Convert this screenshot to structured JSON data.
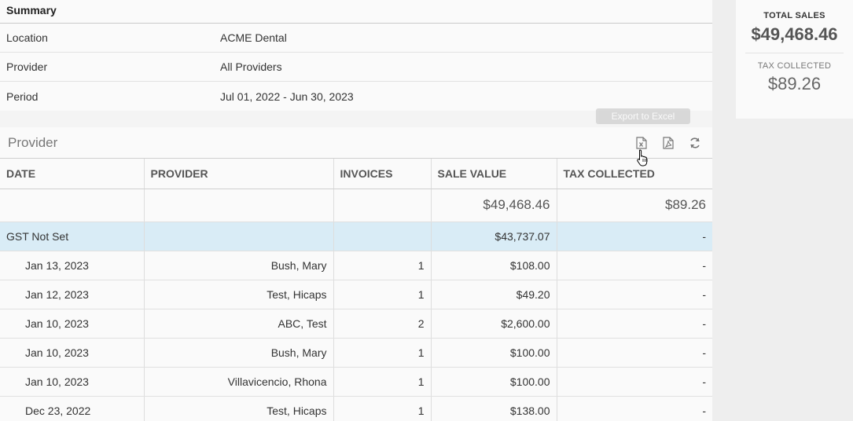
{
  "summary": {
    "title": "Summary",
    "rows": [
      {
        "label": "Location",
        "value": "ACME Dental"
      },
      {
        "label": "Provider",
        "value": "All Providers"
      },
      {
        "label": "Period",
        "value": "Jul 01, 2022 - Jun 30, 2023"
      }
    ]
  },
  "panel": {
    "title": "Provider",
    "tooltip": "Export to Excel",
    "tools": [
      "excel-export-icon",
      "pdf-export-icon",
      "refresh-icon"
    ]
  },
  "table": {
    "headers": [
      "DATE",
      "PROVIDER",
      "INVOICES",
      "SALE VALUE",
      "TAX COLLECTED"
    ],
    "totals": {
      "sale_value": "$49,468.46",
      "tax_collected": "$89.26"
    },
    "group": {
      "label": "GST Not Set",
      "sale_value": "$43,737.07",
      "tax_collected": "-"
    },
    "rows": [
      {
        "date": "Jan 13, 2023",
        "provider": "Bush, Mary",
        "invoices": "1",
        "sale_value": "$108.00",
        "tax": "-"
      },
      {
        "date": "Jan 12, 2023",
        "provider": "Test, Hicaps",
        "invoices": "1",
        "sale_value": "$49.20",
        "tax": "-"
      },
      {
        "date": "Jan 10, 2023",
        "provider": "ABC, Test",
        "invoices": "2",
        "sale_value": "$2,600.00",
        "tax": "-"
      },
      {
        "date": "Jan 10, 2023",
        "provider": "Bush, Mary",
        "invoices": "1",
        "sale_value": "$100.00",
        "tax": "-"
      },
      {
        "date": "Jan 10, 2023",
        "provider": "Villavicencio, Rhona",
        "invoices": "1",
        "sale_value": "$100.00",
        "tax": "-"
      },
      {
        "date": "Dec 23, 2022",
        "provider": "Test, Hicaps",
        "invoices": "1",
        "sale_value": "$138.00",
        "tax": "-"
      }
    ]
  },
  "stats": {
    "total_sales_label": "TOTAL SALES",
    "total_sales_value": "$49,468.46",
    "tax_collected_label": "TAX COLLECTED",
    "tax_collected_value": "$89.26"
  },
  "colors": {
    "group_row": "#d9ecf6",
    "panel_bg": "#fafafa",
    "page_bg": "#eeeeee"
  }
}
